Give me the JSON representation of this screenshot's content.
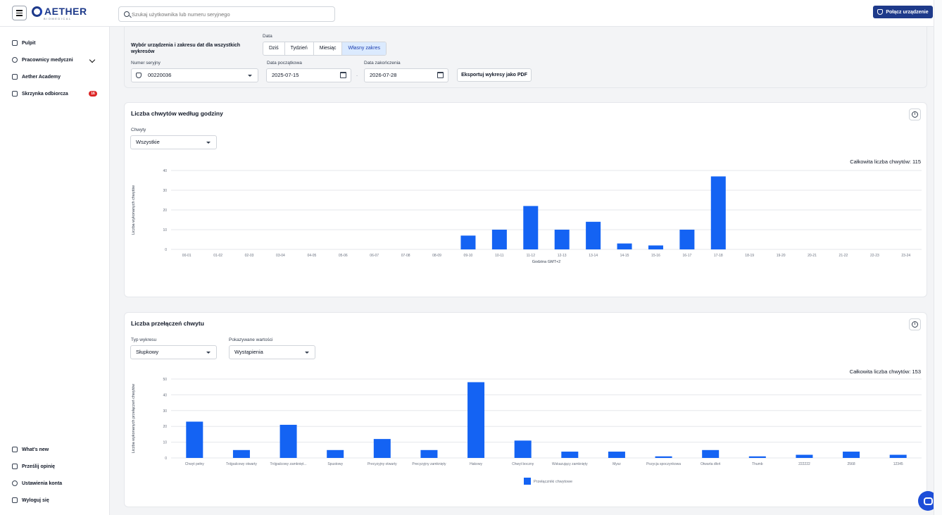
{
  "header": {
    "logo_text": "AETHER",
    "logo_subtext": "BIOMEDICAL",
    "search_placeholder": "Szukaj użytkownika lub numeru seryjnego",
    "connect_label": "Połącz urządzenie"
  },
  "sidebar": {
    "items": [
      {
        "label": "Pulpit",
        "icon": "home-icon"
      },
      {
        "label": "Pracownicy medyczni",
        "icon": "shield-icon"
      },
      {
        "label": "Aether Academy",
        "icon": "graduation-cap-icon"
      },
      {
        "label": "Skrzynka odbiorcza",
        "icon": "inbox-icon",
        "badge": "16"
      }
    ],
    "bottom_items": [
      {
        "label": "What's new",
        "icon": "megaphone-icon"
      },
      {
        "label": "Prześlij opinię",
        "icon": "feedback-icon"
      },
      {
        "label": "Ustawienia konta",
        "icon": "gear-icon"
      },
      {
        "label": "Wyloguj się",
        "icon": "logout-icon"
      }
    ]
  },
  "filters": {
    "title": "Wybór urządzenia i zakresu dat dla wszystkich wykresów",
    "date_label": "Data",
    "ranges": [
      "Dziś",
      "Tydzień",
      "Miesiąc",
      "Własny zakres"
    ],
    "active_range": "Własny zakres",
    "serial_label": "Numer seryjny",
    "serial_value": "00220036",
    "start_label": "Data początkowa",
    "start_value": "2025-07-15",
    "end_label": "Data zakończenia",
    "end_value": "2026-07-28",
    "export_label": "Eksportuj wykresy jako PDF",
    "range_separator": "-"
  },
  "chart1_card": {
    "title": "Liczba chwytów według godziny",
    "filter_label": "Chwyty",
    "filter_value": "Wszystkie",
    "total_text": "Całkowita liczba chwytów: 115"
  },
  "chart2_card": {
    "title": "Liczba przełączeń chwytu",
    "type_label": "Typ wykresu",
    "type_value": "Słupkowy",
    "values_label": "Pokazywane wartości",
    "values_value": "Wystąpienia",
    "total_text": "Całkowita liczba chwytów: 153"
  },
  "chart_data": [
    {
      "type": "bar",
      "xlabel": "Godzina GMT+2",
      "ylabel": "Liczba wykonanych chwytów",
      "ylim": [
        0,
        40
      ],
      "yticks": [
        0,
        10,
        20,
        30,
        40
      ],
      "grid": true,
      "color": "#1463f3",
      "categories": [
        "00-01",
        "01-02",
        "02-03",
        "03-04",
        "04-05",
        "05-06",
        "06-07",
        "07-08",
        "08-09",
        "09-10",
        "10-11",
        "11-12",
        "12-13",
        "13-14",
        "14-15",
        "15-16",
        "16-17",
        "17-18",
        "18-19",
        "19-20",
        "20-21",
        "21-22",
        "22-23",
        "23-24"
      ],
      "values": [
        0,
        0,
        0,
        0,
        0,
        0,
        0,
        0,
        0,
        7,
        10,
        22,
        10,
        14,
        3,
        2,
        10,
        37,
        0,
        0,
        0,
        0,
        0,
        0
      ]
    },
    {
      "type": "bar",
      "xlabel": "",
      "ylabel": "Liczba wykonanych przełączeń chwytów",
      "ylim": [
        0,
        50
      ],
      "yticks": [
        0,
        10,
        20,
        30,
        40,
        50
      ],
      "grid": true,
      "legend_position": "bottom",
      "color": "#1463f3",
      "categories": [
        "Chwyt pełny",
        "Trójpalcowy otwarty",
        "Trójpalcowy zamknięt...",
        "Spustowy",
        "Precyzyjny otwarty",
        "Precyzyjny zamknięty",
        "Hakowy",
        "Chwyt boczny",
        "Wskazujący zamknięty",
        "Mysz",
        "Pozycja spoczynkowa",
        "Otwarta dłoń",
        "Thumb",
        "222222",
        "2568",
        "12345"
      ],
      "series": [
        {
          "name": "Przełączniki chwytowe",
          "values": [
            23,
            5,
            21,
            5,
            12,
            5,
            48,
            11,
            4,
            4,
            1,
            5,
            1,
            2,
            4,
            2
          ]
        }
      ]
    }
  ]
}
